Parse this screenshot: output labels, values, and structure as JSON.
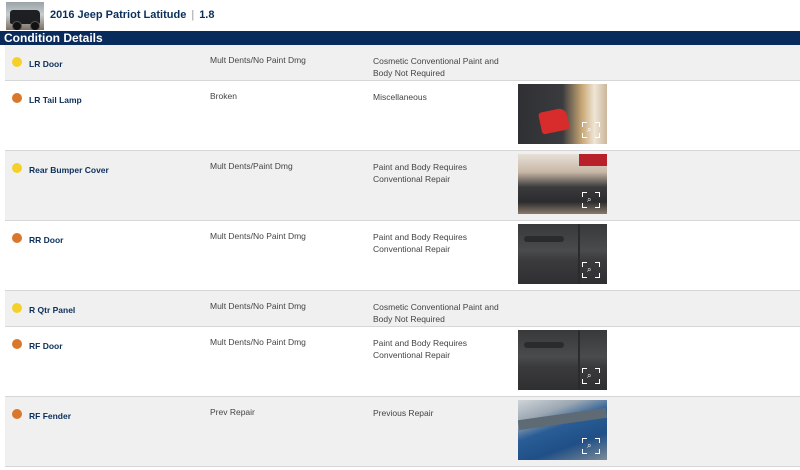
{
  "vehicle": {
    "title": "2016 Jeep Patriot Latitude",
    "separator": "|",
    "grade": "1.8",
    "thumbnail_icon": "vehicle-photo"
  },
  "section": {
    "title": "Condition Details"
  },
  "severity_colors": {
    "yellow": "#f5d02a",
    "orange": "#d9782c"
  },
  "damages": [
    {
      "part": "LR Door",
      "severity": "yellow",
      "description": "Mult Dents/No Paint Dmg",
      "condition": "Cosmetic Conventional Paint and Body Not Required",
      "photo": null
    },
    {
      "part": "LR Tail Lamp",
      "severity": "orange",
      "description": "Broken",
      "condition": "Miscellaneous",
      "photo": "taillamp"
    },
    {
      "part": "Rear Bumper Cover",
      "severity": "yellow",
      "description": "Mult Dents/Paint Dmg",
      "condition": "Paint and Body Requires Conventional Repair",
      "photo": "bumper"
    },
    {
      "part": "RR Door",
      "severity": "orange",
      "description": "Mult Dents/No Paint Dmg",
      "condition": "Paint and Body Requires Conventional Repair",
      "photo": "door"
    },
    {
      "part": "R Qtr Panel",
      "severity": "yellow",
      "description": "Mult Dents/No Paint Dmg",
      "condition": "Cosmetic Conventional Paint and Body Not Required",
      "photo": null
    },
    {
      "part": "RF Door",
      "severity": "orange",
      "description": "Mult Dents/No Paint Dmg",
      "condition": "Paint and Body Requires Conventional Repair",
      "photo": "door"
    },
    {
      "part": "RF Fender",
      "severity": "orange",
      "description": "Prev Repair",
      "condition": "Previous Repair",
      "photo": "fender"
    }
  ]
}
